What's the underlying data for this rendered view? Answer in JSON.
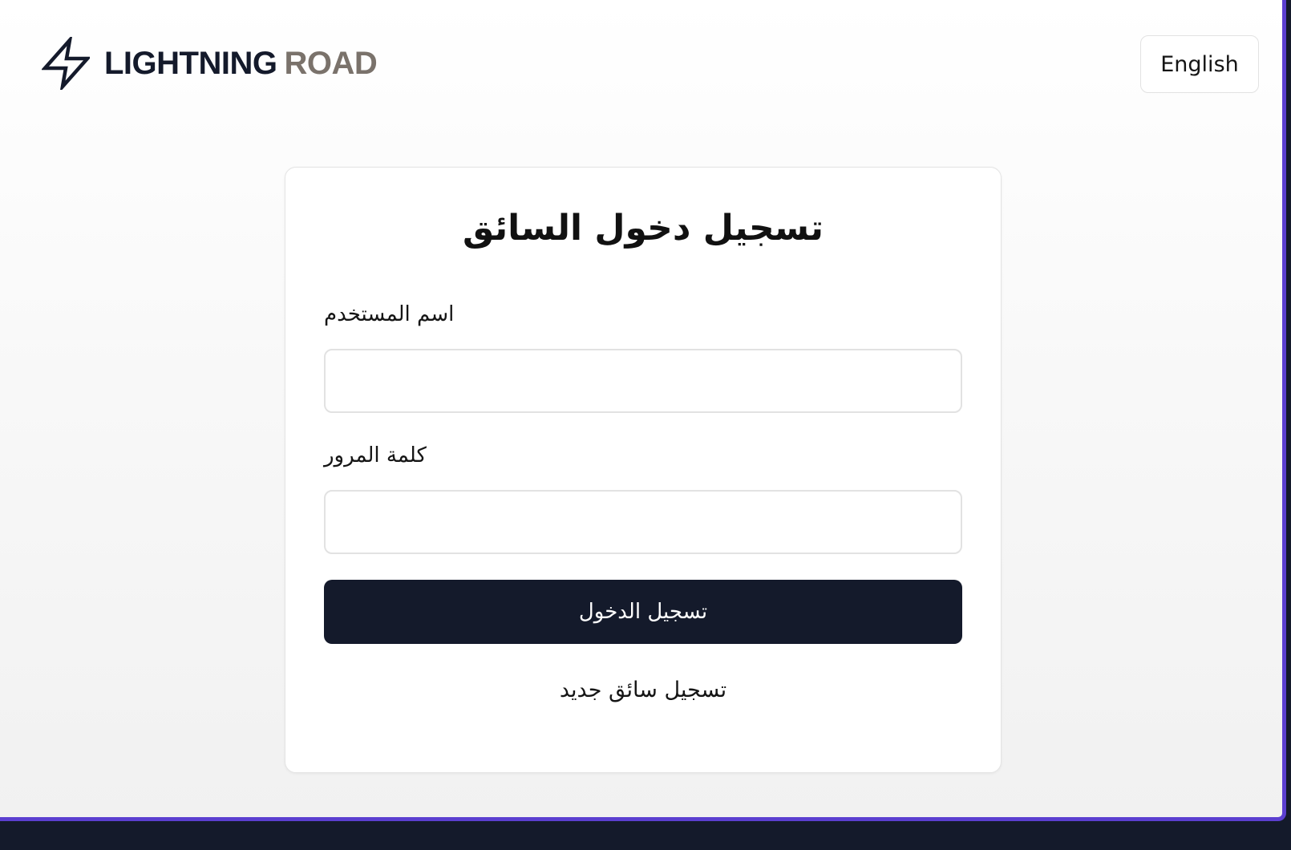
{
  "brand": {
    "name_primary": "LIGHTNING",
    "name_secondary": "ROAD",
    "icon": "lightning-bolt-icon"
  },
  "header": {
    "language_button_label": "English"
  },
  "login_form": {
    "title": "تسجيل دخول السائق",
    "username_label": "اسم المستخدم",
    "username_value": "",
    "password_label": "كلمة المرور",
    "password_value": "",
    "submit_label": "تسجيل الدخول",
    "register_link_label": "تسجيل سائق جديد"
  },
  "colors": {
    "primary": "#141a2b",
    "brand_secondary": "#7a726b",
    "frame_accent": "#5b3fd0"
  }
}
